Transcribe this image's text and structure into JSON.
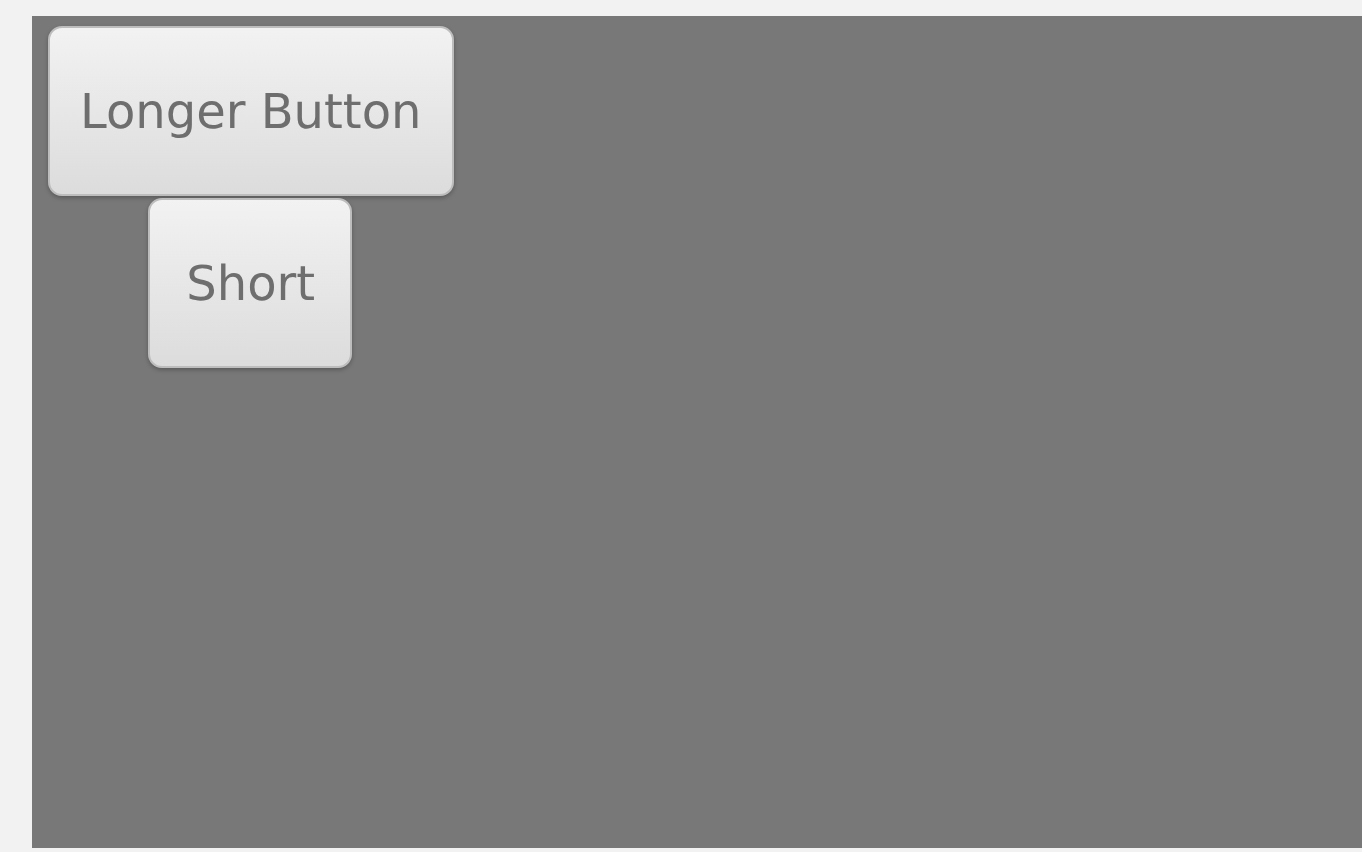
{
  "buttons": [
    {
      "label": "Longer Button"
    },
    {
      "label": "Short"
    }
  ]
}
